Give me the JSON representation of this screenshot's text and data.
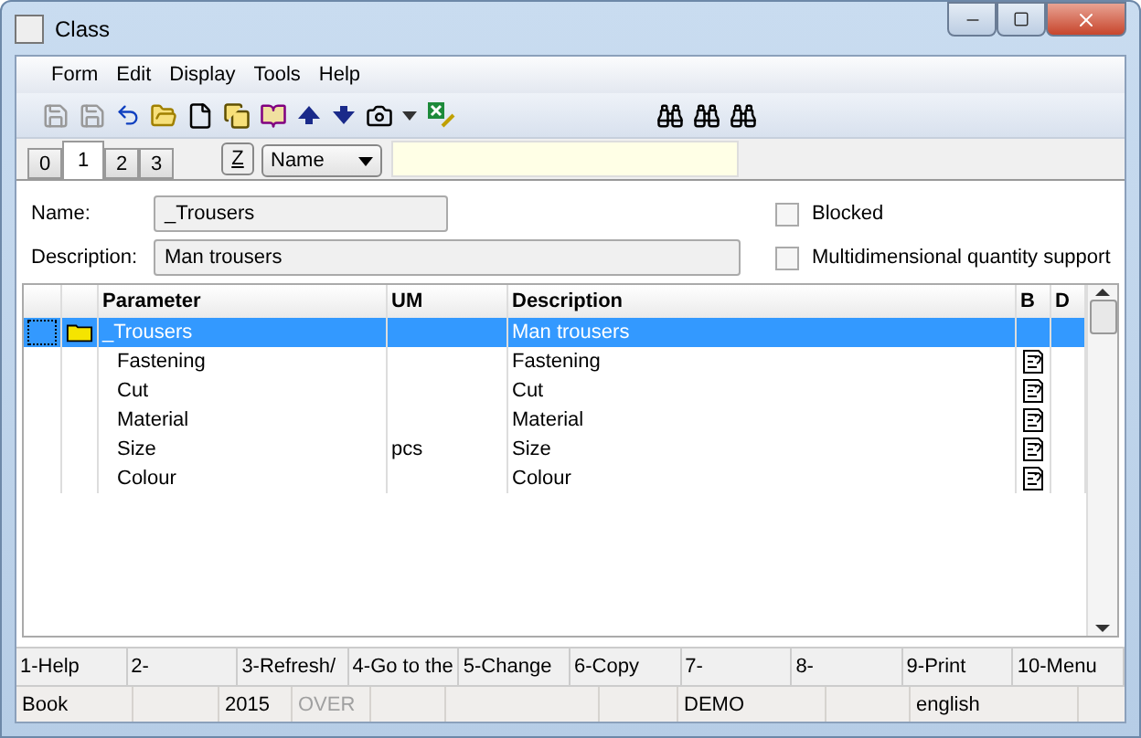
{
  "window": {
    "title": "Class"
  },
  "menu": [
    "Form",
    "Edit",
    "Display",
    "Tools",
    "Help"
  ],
  "tabs": [
    {
      "label": "0",
      "selected": false
    },
    {
      "label": "1",
      "selected": true
    },
    {
      "label": "2",
      "selected": false
    },
    {
      "label": "3",
      "selected": false
    }
  ],
  "sort_button": "Z",
  "sort_field": {
    "value": "Name"
  },
  "form": {
    "name_label": "Name:",
    "name_value": "_Trousers",
    "description_label": "Description:",
    "description_value": "Man trousers",
    "checkboxes": [
      {
        "label": "Blocked",
        "checked": false
      },
      {
        "label": "Multidimensional quantity support",
        "checked": false
      }
    ]
  },
  "table": {
    "columns": [
      "Parameter",
      "UM",
      "Description",
      "B",
      "D"
    ],
    "rows": [
      {
        "kind": "folder",
        "parameter": "_Trousers",
        "um": "",
        "description": "Man trousers",
        "note": false,
        "selected": true
      },
      {
        "kind": "item",
        "parameter": "Fastening",
        "um": "",
        "description": "Fastening",
        "note": true,
        "selected": false
      },
      {
        "kind": "item",
        "parameter": "Cut",
        "um": "",
        "description": "Cut",
        "note": true,
        "selected": false
      },
      {
        "kind": "item",
        "parameter": "Material",
        "um": "",
        "description": "Material",
        "note": true,
        "selected": false
      },
      {
        "kind": "item",
        "parameter": "Size",
        "um": "pcs",
        "description": "Size",
        "note": true,
        "selected": false
      },
      {
        "kind": "item",
        "parameter": "Colour",
        "um": "",
        "description": "Colour",
        "note": true,
        "selected": false
      }
    ]
  },
  "function_keys": [
    "1-Help",
    "2-",
    "3-Refresh/",
    "4-Go to the",
    "5-Change",
    "6-Copy",
    "7-",
    "8-",
    "9-Print",
    "10-Menu"
  ],
  "status_bar": [
    {
      "kind": "text",
      "text": "Book",
      "disabled": false
    },
    {
      "kind": "blank"
    },
    {
      "kind": "text",
      "text": "2015",
      "disabled": false
    },
    {
      "kind": "text",
      "text": "OVER",
      "disabled": true
    },
    {
      "kind": "blank"
    },
    {
      "kind": "blank"
    },
    {
      "kind": "blank"
    },
    {
      "kind": "text",
      "text": "DEMO",
      "disabled": false
    },
    {
      "kind": "blank"
    },
    {
      "kind": "text",
      "text": "english",
      "disabled": false
    }
  ]
}
